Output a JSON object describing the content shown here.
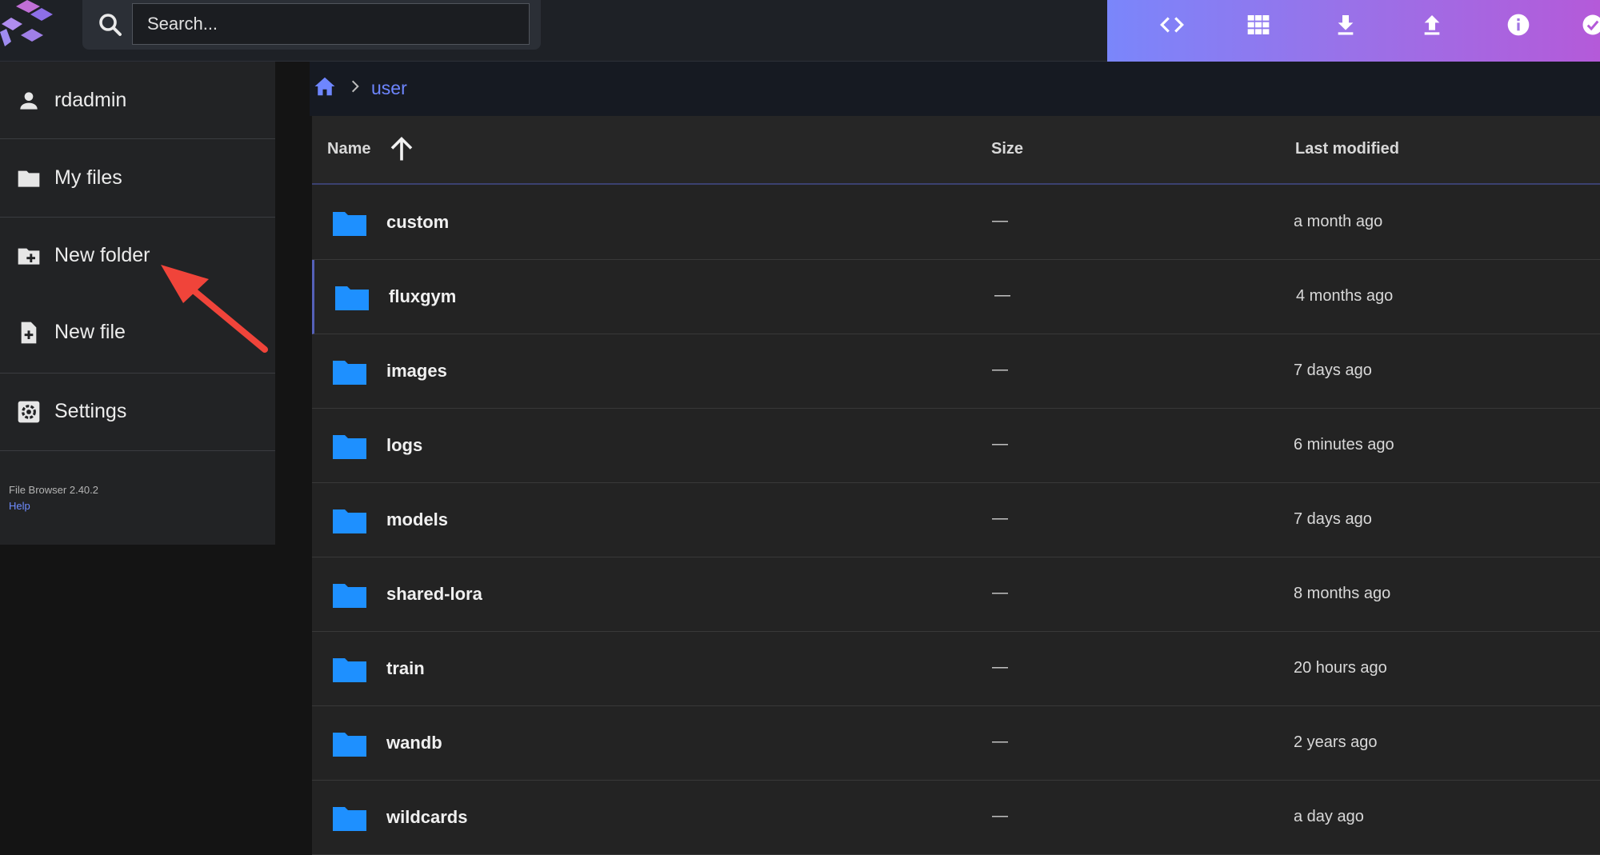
{
  "search": {
    "placeholder": "Search..."
  },
  "toolbar": {
    "buttons": [
      {
        "icon": "code-icon"
      },
      {
        "icon": "grid-view-icon"
      },
      {
        "icon": "download-icon"
      },
      {
        "icon": "upload-icon"
      },
      {
        "icon": "info-icon"
      },
      {
        "icon": "check-circle-icon"
      }
    ]
  },
  "sidebar": {
    "items": [
      {
        "label": "rdadmin",
        "icon": "person-icon"
      },
      {
        "label": "My files",
        "icon": "folder-icon"
      },
      {
        "label": "New folder",
        "icon": "new-folder-icon"
      },
      {
        "label": "New file",
        "icon": "new-file-icon"
      },
      {
        "label": "Settings",
        "icon": "settings-icon"
      }
    ],
    "version": "File Browser 2.40.2",
    "help": "Help"
  },
  "breadcrumb": {
    "current": "user"
  },
  "table": {
    "headers": {
      "name": "Name",
      "size": "Size",
      "modified": "Last modified"
    },
    "rows": [
      {
        "name": "custom",
        "size": "—",
        "modified": "a month ago"
      },
      {
        "name": "fluxgym",
        "size": "—",
        "modified": "4 months ago"
      },
      {
        "name": "images",
        "size": "—",
        "modified": "7 days ago"
      },
      {
        "name": "logs",
        "size": "—",
        "modified": "6 minutes ago"
      },
      {
        "name": "models",
        "size": "—",
        "modified": "7 days ago"
      },
      {
        "name": "shared-lora",
        "size": "—",
        "modified": "8 months ago"
      },
      {
        "name": "train",
        "size": "—",
        "modified": "20 hours ago"
      },
      {
        "name": "wandb",
        "size": "—",
        "modified": "2 years ago"
      },
      {
        "name": "wildcards",
        "size": "—",
        "modified": "a day ago"
      }
    ]
  },
  "colors": {
    "folder": "#1e90ff",
    "accent": "#6e86ff",
    "annotation": "#f0443a"
  }
}
